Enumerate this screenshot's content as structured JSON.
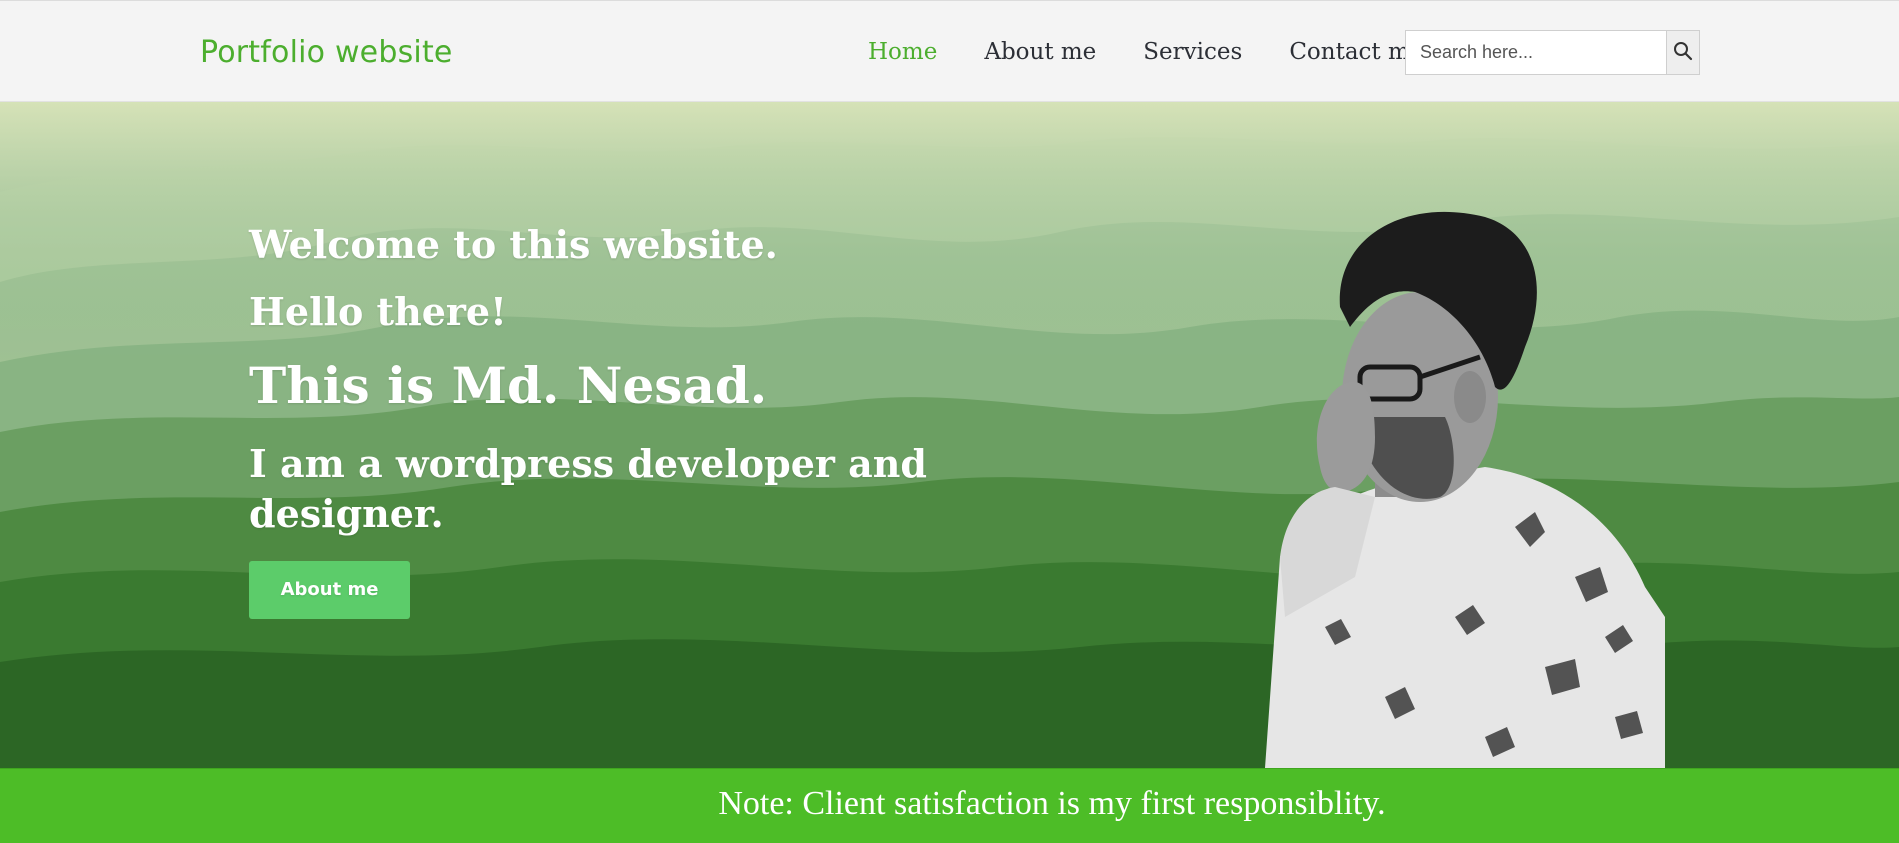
{
  "header": {
    "logo_text": "Portfolio website",
    "nav": [
      {
        "label": "Home",
        "active": true
      },
      {
        "label": "About me",
        "active": false
      },
      {
        "label": "Services",
        "active": false
      },
      {
        "label": "Contact me",
        "active": false
      }
    ],
    "search": {
      "placeholder": "Search here...",
      "value": ""
    }
  },
  "hero": {
    "welcome": "Welcome to this website.",
    "hello": "Hello there!",
    "name": "This is Md. Nesad.",
    "role": "I am a wordpress developer and designer.",
    "button_label": "About me"
  },
  "note_bar": {
    "text": "Note: Client satisfaction is my first responsiblity."
  },
  "icons": {
    "search": "search-icon"
  },
  "colors": {
    "accent": "#4cae2e",
    "button": "#5ccc6a",
    "note_bar": "#4dbd27",
    "nav_text": "#2c2f36"
  }
}
